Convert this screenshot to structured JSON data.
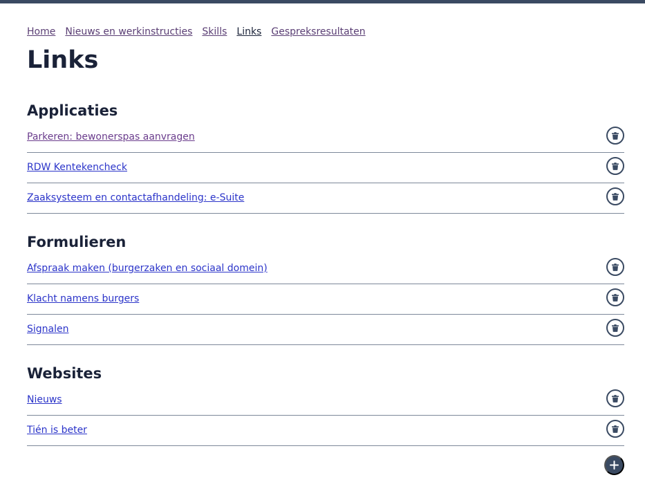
{
  "breadcrumb": [
    {
      "label": "Home"
    },
    {
      "label": "Nieuws en werkinstructies"
    },
    {
      "label": "Skills"
    },
    {
      "label": "Links",
      "current": true
    },
    {
      "label": "Gespreksresultaten"
    }
  ],
  "page": {
    "title": "Links"
  },
  "sections": [
    {
      "title": "Applicaties",
      "links": [
        {
          "label": "Parkeren: bewonerspas aanvragen",
          "visited": true
        },
        {
          "label": "RDW Kentekencheck"
        },
        {
          "label": "Zaaksysteem en contactafhandeling: e-Suite"
        }
      ]
    },
    {
      "title": "Formulieren",
      "links": [
        {
          "label": "Afspraak maken (burgerzaken en sociaal domein)"
        },
        {
          "label": "Klacht namens burgers"
        },
        {
          "label": "Signalen"
        }
      ]
    },
    {
      "title": "Websites",
      "links": [
        {
          "label": "Nieuws"
        },
        {
          "label": "Tién is beter"
        }
      ]
    }
  ],
  "icons": {
    "delete": "trash-icon",
    "add": "plus-icon"
  },
  "colors": {
    "topbar": "#3a4a62",
    "link": "#2b34c9",
    "visited_link": "#6a3c8c",
    "button": "#3a4a62",
    "divider": "#7c8799"
  }
}
